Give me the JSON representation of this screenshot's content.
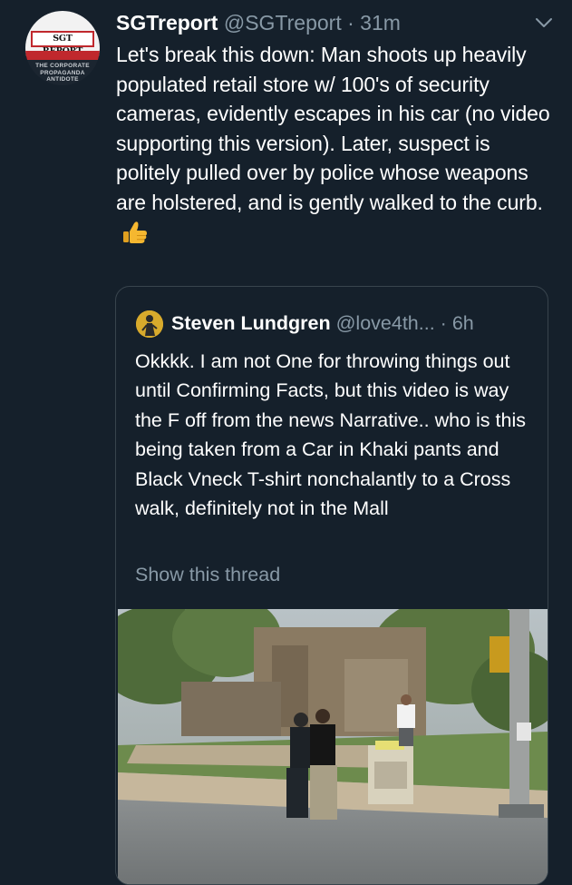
{
  "tweet": {
    "avatar": {
      "banner_text": "SGT REPORT",
      "tagline": [
        "THE CORPORATE",
        "PROPAGANDA",
        "ANTIDOTE"
      ]
    },
    "display_name": "SGTreport",
    "handle": "@SGTreport",
    "separator": "·",
    "time": "31m",
    "text": "Let's break this down: Man shoots up heavily populated retail store w/ 100's of security cameras, evidently escapes in his car (no video supporting this version). Later, suspect is politely pulled over by police whose weapons are holstered, and is gently walked to the curb.",
    "icons": {
      "menu": "chevron-down-icon",
      "emoji": "thumbs-up-icon"
    }
  },
  "quote": {
    "display_name": "Steven Lundgren",
    "handle": "@love4th...",
    "separator": "·",
    "time": "6h",
    "text": "Okkkk. I am not One for throwing things out until Confirming Facts, but this video is way the F off from the news Narrative.. who is this being taken from a Car in Khaki pants and Black Vneck T-shirt nonchalantly to a Cross walk, definitely not in the Mall",
    "show_thread": "Show this thread"
  },
  "colors": {
    "background": "#15202b",
    "text": "#ffffff",
    "muted": "#8899a6",
    "border": "#38444d",
    "brand_red": "#c0282d",
    "emoji": "#f5b730"
  }
}
